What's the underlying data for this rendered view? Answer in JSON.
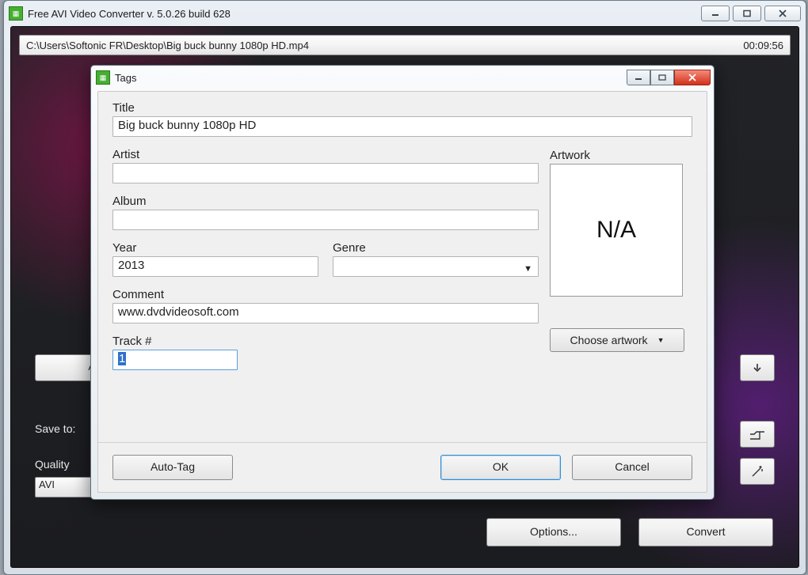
{
  "app": {
    "title": "Free AVI Video Converter  v. 5.0.26 build 628"
  },
  "filebar": {
    "path": "C:\\Users\\Softonic FR\\Desktop\\Big buck bunny 1080p HD.mp4",
    "duration": "00:09:56"
  },
  "left_controls": {
    "partial_button": "A",
    "save_to_label": "Save to:",
    "quality_label": "Quality",
    "quality_value": "AVI"
  },
  "bottom": {
    "options": "Options...",
    "convert": "Convert"
  },
  "dialog": {
    "title": "Tags",
    "labels": {
      "title": "Title",
      "artist": "Artist",
      "album": "Album",
      "year": "Year",
      "genre": "Genre",
      "comment": "Comment",
      "track": "Track #",
      "artwork": "Artwork"
    },
    "values": {
      "title": "Big buck bunny 1080p HD",
      "artist": "",
      "album": "",
      "year": "2013",
      "genre": "",
      "comment": "www.dvdvideosoft.com",
      "track": "1",
      "artwork_placeholder": "N/A"
    },
    "buttons": {
      "choose_artwork": "Choose artwork",
      "auto_tag": "Auto-Tag",
      "ok": "OK",
      "cancel": "Cancel"
    }
  }
}
